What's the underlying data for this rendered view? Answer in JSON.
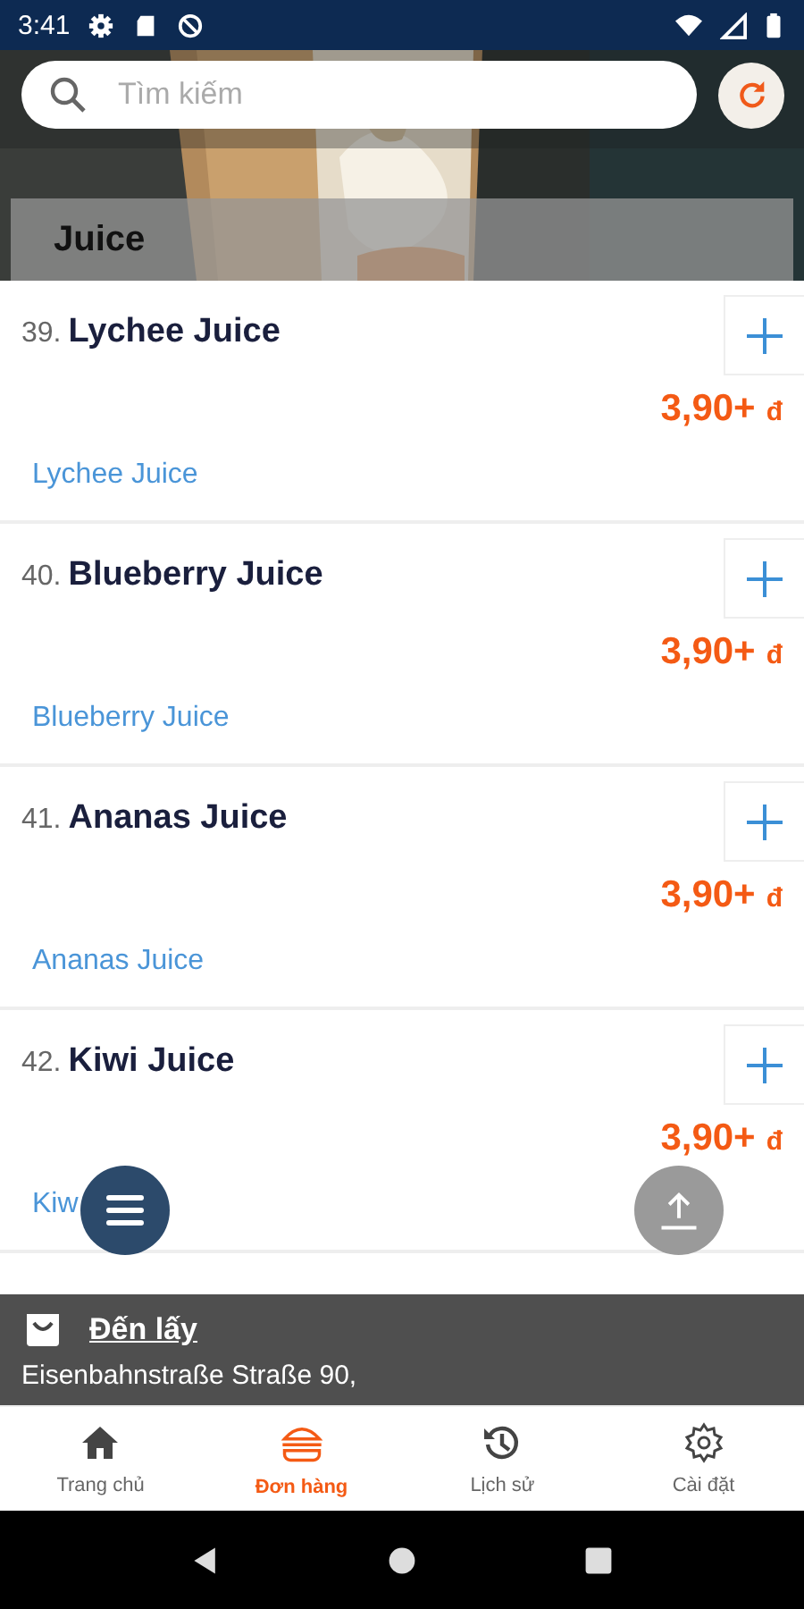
{
  "status_bar": {
    "time": "3:41"
  },
  "search": {
    "placeholder": "Tìm kiếm"
  },
  "category": {
    "title": "Juice"
  },
  "products": [
    {
      "number": "39.",
      "name": "Lychee Juice",
      "price": "3,90+",
      "currency": "đ",
      "subtitle": "Lychee Juice"
    },
    {
      "number": "40.",
      "name": "Blueberry Juice",
      "price": "3,90+",
      "currency": "đ",
      "subtitle": "Blueberry Juice"
    },
    {
      "number": "41.",
      "name": "Ananas Juice",
      "price": "3,90+",
      "currency": "đ",
      "subtitle": "Ananas Juice"
    },
    {
      "number": "42.",
      "name": "Kiwi Juice",
      "price": "3,90+",
      "currency": "đ",
      "subtitle": "Kiw"
    }
  ],
  "order_bar": {
    "mode": "Đến lấy",
    "address": "Eisenbahnstraße Straße 90,"
  },
  "bottom_nav": [
    {
      "kind": "home",
      "label": "Trang chủ",
      "selected": false
    },
    {
      "kind": "orders",
      "label": "Đơn hàng",
      "selected": true
    },
    {
      "kind": "history",
      "label": "Lịch sử",
      "selected": false
    },
    {
      "kind": "settings",
      "label": "Cài đặt",
      "selected": false
    }
  ]
}
